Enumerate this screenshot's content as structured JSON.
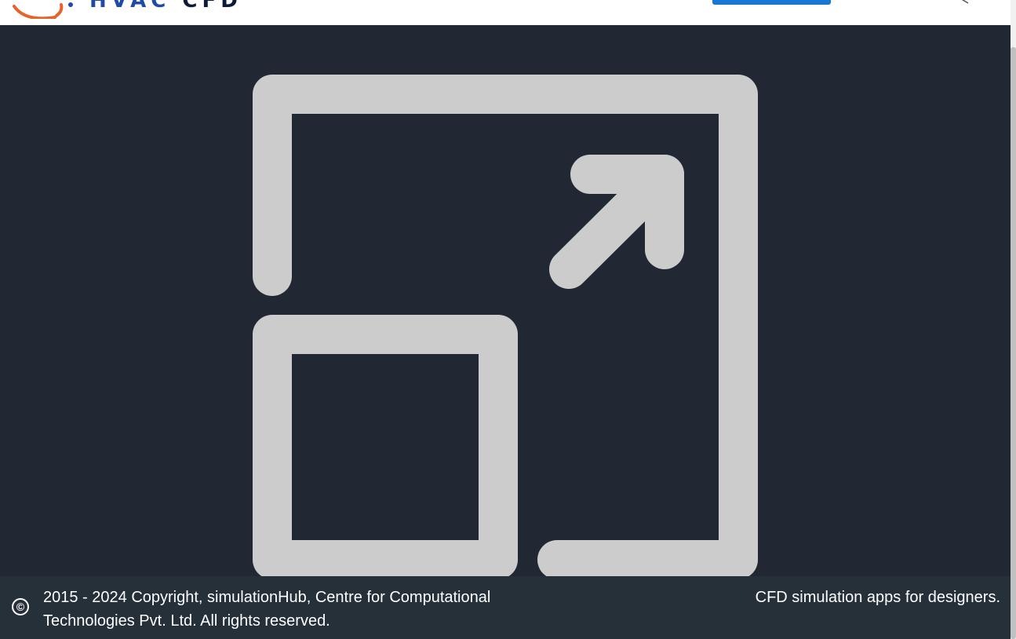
{
  "header": {
    "logo_hvac": "HVAC",
    "logo_cfd": "CFD",
    "primary_button_label": ""
  },
  "main": {
    "icon": "expand-fullscreen-icon",
    "icon_color": "#cccccc",
    "background": "#222833"
  },
  "footer": {
    "copyright_icon": "©",
    "copyright_text": "2015 - 2024 Copyright, simulationHub, Centre for Computational Technologies Pvt. Ltd. All rights reserved.",
    "tagline": "CFD simulation apps for designers."
  },
  "colors": {
    "brand_blue": "#1f4aa8",
    "brand_orange": "#e8622c",
    "button_blue": "#1976d2",
    "footer_bg": "#263038"
  }
}
